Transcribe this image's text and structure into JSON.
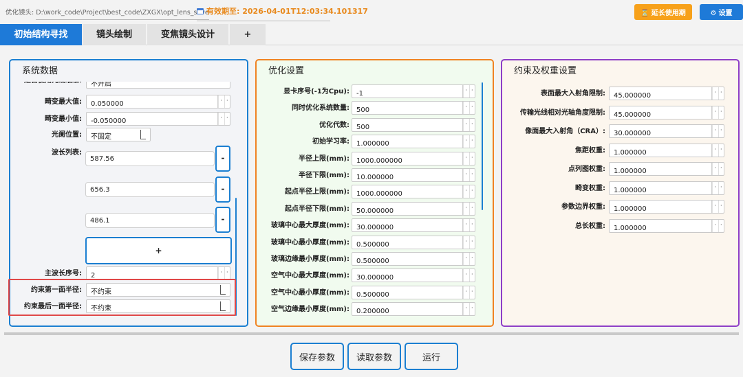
{
  "top": {
    "path_label": "优化镜头:",
    "path_value": "D:\\work_code\\Project\\best_code\\ZXGX\\opt_lens_save",
    "expiry_label": "有效期至:",
    "expiry_value": "2026-04-01T12:03:34.101317",
    "extend_button": "延长使用期",
    "settings_button": "设置"
  },
  "tabs": [
    {
      "label": "初始结构寻找",
      "active": true
    },
    {
      "label": "镜头绘制",
      "active": false
    },
    {
      "label": "变焦镜头设计",
      "active": false
    },
    {
      "label": "+",
      "active": false
    }
  ],
  "system": {
    "title": "系统数据",
    "partial_row": {
      "label": "是否使用光线瞄准:",
      "value": "不开启"
    },
    "distortion_max": {
      "label": "畸变最大值:",
      "value": "0.050000"
    },
    "distortion_min": {
      "label": "畸变最小值:",
      "value": "-0.050000"
    },
    "stop_position": {
      "label": "光阑位置:",
      "value": "不固定"
    },
    "wavelength_label": "波长列表:",
    "wavelengths": [
      "587.56",
      "656.3",
      "486.1"
    ],
    "remove_label": "-",
    "add_label": "+",
    "main_wavelength": {
      "label": "主波长序号:",
      "value": "2"
    },
    "first_surface": {
      "label": "约束第一面半径:",
      "value": "不约束"
    },
    "last_surface": {
      "label": "约束最后一面半径:",
      "value": "不约束"
    }
  },
  "optimization": {
    "title": "优化设置",
    "rows": [
      {
        "label": "显卡序号(-1为Cpu):",
        "value": "-1"
      },
      {
        "label": "同时优化系统数量:",
        "value": "500"
      },
      {
        "label": "优化代数:",
        "value": "500"
      },
      {
        "label": "初始学习率:",
        "value": "1.000000"
      },
      {
        "label": "半径上限(mm):",
        "value": "1000.000000"
      },
      {
        "label": "半径下限(mm):",
        "value": "10.000000"
      },
      {
        "label": "起点半径上限(mm):",
        "value": "1000.000000"
      },
      {
        "label": "起点半径下限(mm):",
        "value": "50.000000"
      },
      {
        "label": "玻璃中心最大厚度(mm):",
        "value": "30.000000"
      },
      {
        "label": "玻璃中心最小厚度(mm):",
        "value": "0.500000"
      },
      {
        "label": "玻璃边缘最小厚度(mm):",
        "value": "0.500000"
      },
      {
        "label": "空气中心最大厚度(mm):",
        "value": "30.000000"
      },
      {
        "label": "空气中心最小厚度(mm):",
        "value": "0.500000"
      },
      {
        "label": "空气边缘最小厚度(mm):",
        "value": "0.200000"
      }
    ]
  },
  "constraints": {
    "title": "约束及权重设置",
    "rows": [
      {
        "label": "表面最大入射角限制:",
        "value": "45.000000"
      },
      {
        "label": "传输光线相对光轴角度限制:",
        "value": "45.000000"
      },
      {
        "label": "像面最大入射角（CRA）:",
        "value": "30.000000"
      },
      {
        "label": "焦距权重:",
        "value": "1.000000"
      },
      {
        "label": "点列图权重:",
        "value": "1.000000"
      },
      {
        "label": "畸变权重:",
        "value": "1.000000"
      },
      {
        "label": "参数边界权重:",
        "value": "1.000000"
      },
      {
        "label": "总长权重:",
        "value": "1.000000"
      }
    ]
  },
  "bottom": {
    "save": "保存参数",
    "load": "读取参数",
    "run": "运行"
  }
}
